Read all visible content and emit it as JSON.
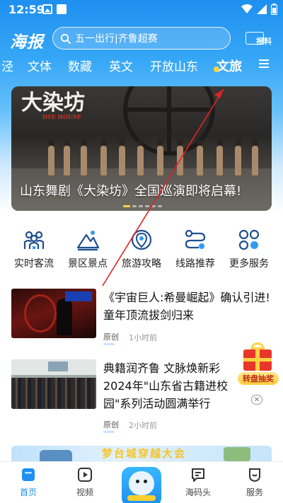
{
  "status_bar": {
    "time": "12:59"
  },
  "header": {
    "logo": "海报",
    "search_placeholder": "五一出行|齐鲁超赛",
    "report_label": "报料"
  },
  "categories": [
    {
      "label": "泾"
    },
    {
      "label": "文体"
    },
    {
      "label": "数藏"
    },
    {
      "label": "英文"
    },
    {
      "label": "开放山东"
    },
    {
      "label": "文旅"
    }
  ],
  "banner": {
    "title": "山东舞剧《大染坊》全国巡演即将启幕!",
    "logo_text": "大染坊",
    "logo_sub": "DYE HOUSE"
  },
  "services": [
    {
      "label": "实时客流",
      "icon": "people-icon"
    },
    {
      "label": "景区景点",
      "icon": "mountain-icon"
    },
    {
      "label": "旅游攻略",
      "icon": "map-pin-icon"
    },
    {
      "label": "线路推荐",
      "icon": "route-icon"
    },
    {
      "label": "更多服务",
      "icon": "grid-icon"
    }
  ],
  "news": [
    {
      "title": "《宇宙巨人:希曼崛起》确认引进!童年顶流拔剑归来",
      "tag": "原创",
      "time": "1小时前"
    },
    {
      "title": "典籍润齐鲁 文脉焕新彩 2024年\"山东省古籍进校园\"系列活动圆满举行",
      "tag": "原创",
      "time": "2小时前"
    }
  ],
  "lottery": {
    "label": "转盘抽奖"
  },
  "promo": {
    "text": "梦台城穿越大会"
  },
  "bottom_nav": [
    {
      "label": "首页",
      "icon": "home-icon",
      "active": true
    },
    {
      "label": "视频",
      "icon": "video-icon",
      "active": false
    },
    {
      "label": "海码头",
      "icon": "chat-icon",
      "active": false
    },
    {
      "label": "服务",
      "icon": "service-icon",
      "active": false
    }
  ],
  "colors": {
    "brand": "#1f8ff0",
    "accent": "#ffd23f",
    "arrow": "#e02424"
  }
}
